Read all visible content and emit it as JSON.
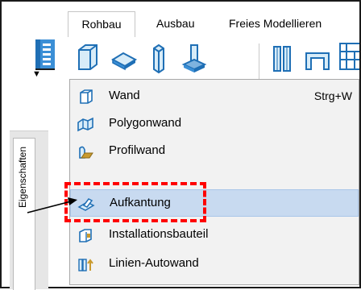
{
  "ribbon": {
    "tabs": [
      {
        "label": "Rohbau",
        "active": true
      },
      {
        "label": "Ausbau",
        "active": false
      },
      {
        "label": "Freies Modellieren",
        "active": false
      }
    ],
    "buttons": [
      {
        "icon": "wall-icon",
        "dropdown": "▼"
      },
      {
        "icon": "slab-icon",
        "dropdown": "▼"
      },
      {
        "icon": "column-icon",
        "dropdown": "▼"
      },
      {
        "icon": "foundation-icon",
        "dropdown": "▼"
      },
      {
        "icon": "wall-opening-icon",
        "dropdown": "▼"
      },
      {
        "icon": "beam-icon",
        "dropdown": "▼"
      },
      {
        "icon": "stairs-icon",
        "dropdown": "▼"
      }
    ]
  },
  "sidebar": {
    "app_icon": "building-icon",
    "app_dropdown": "▼",
    "panel_label": "Eigenschaften"
  },
  "menu": {
    "items": [
      {
        "label": "Wand",
        "shortcut": "Strg+W",
        "icon": "wall-icon",
        "highlighted": false
      },
      {
        "label": "Polygonwand",
        "shortcut": "",
        "icon": "polygon-wall-icon",
        "highlighted": false
      },
      {
        "label": "Profilwand",
        "shortcut": "",
        "icon": "profile-wall-icon",
        "highlighted": false
      },
      {
        "label": "Aufkantung",
        "shortcut": "",
        "icon": "upstand-icon",
        "highlighted": true
      },
      {
        "label": "Installationsbauteil",
        "shortcut": "",
        "icon": "installation-element-icon",
        "highlighted": false
      },
      {
        "label": "Linien-Autowand",
        "shortcut": "",
        "icon": "line-autowall-icon",
        "highlighted": false
      }
    ]
  },
  "colors": {
    "highlight": "#c8daf0",
    "annotation": "#ff0000",
    "menu_bg": "#f2f2f2"
  }
}
